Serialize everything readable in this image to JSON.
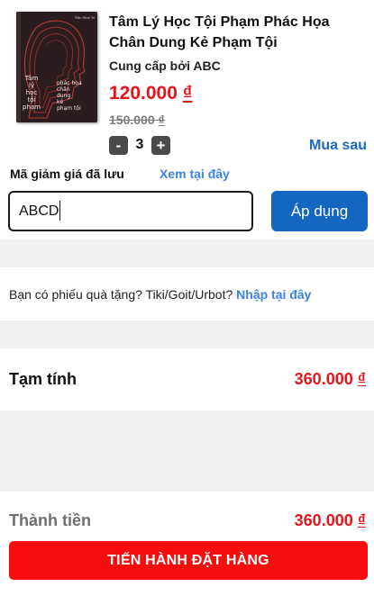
{
  "product": {
    "title": "Tâm Lý Học Tội Phạm Phác Họa Chân Dung Kẻ Phạm Tội",
    "seller": "Cung cấp bởi ABC",
    "price": "120.000",
    "old_price": "150.000",
    "currency": "₫",
    "quantity": "3",
    "decrement_label": "-",
    "increment_label": "+",
    "buy_later": "Mua sau",
    "cover": {
      "title_lines": [
        "Tâm",
        "lý",
        "học",
        "tội",
        "phạm"
      ],
      "subtitle_lines": [
        "phác họa",
        "chân",
        "dung",
        "kẻ",
        "phạm tội"
      ],
      "author": "Trần Minh Trí"
    }
  },
  "coupon": {
    "label": "Mã giảm giá đã lưu",
    "view_link": "Xem tại đây",
    "code_value": "ABCD",
    "apply_label": "Áp dụng"
  },
  "gift": {
    "text": "Bạn có phiếu quà tặng? Tiki/Goit/Urbot? ",
    "link": "Nhập tại đây"
  },
  "summary": {
    "subtotal_label": "Tạm tính",
    "subtotal_value": "360.000",
    "total_label": "Thành tiền",
    "total_value": "360.000",
    "currency": "₫"
  },
  "checkout_label": "TIẾN HÀNH ĐẶT HÀNG",
  "colors": {
    "accent_red": "#e8141b",
    "link_blue": "#3b82e0",
    "apply_blue": "#1566c0",
    "checkout_red": "#f70d0d",
    "section_gray": "#efefef"
  }
}
